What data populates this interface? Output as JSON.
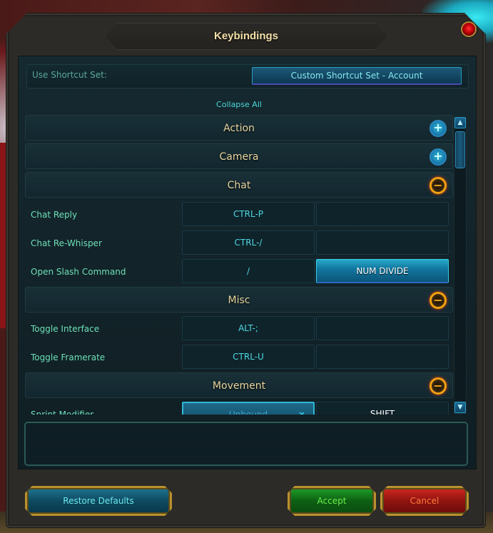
{
  "window": {
    "title": "Keybindings",
    "close_icon": "close-red-orb-icon"
  },
  "shortcut_set": {
    "label": "Use Shortcut Set:",
    "selected": "Custom Shortcut Set - Account"
  },
  "collapse_all_label": "Collapse All",
  "categories": [
    {
      "name": "Action",
      "state": "collapsed",
      "toggle_icon": "plus-icon",
      "toggle_glyph": "+"
    },
    {
      "name": "Camera",
      "state": "collapsed",
      "toggle_icon": "plus-icon",
      "toggle_glyph": "+"
    },
    {
      "name": "Chat",
      "state": "expanded",
      "toggle_icon": "minus-icon",
      "toggle_glyph": "−",
      "bindings": [
        {
          "action": "Chat Reply",
          "primary": "CTRL-P",
          "secondary": ""
        },
        {
          "action": "Chat Re-Whisper",
          "primary": "CTRL-/",
          "secondary": ""
        },
        {
          "action": "Open Slash Command",
          "primary": "/",
          "secondary": "NUM DIVIDE"
        }
      ]
    },
    {
      "name": "Misc",
      "state": "expanded",
      "toggle_icon": "minus-icon",
      "toggle_glyph": "−",
      "bindings": [
        {
          "action": "Toggle Interface",
          "primary": "ALT-;",
          "secondary": ""
        },
        {
          "action": "Toggle Framerate",
          "primary": "CTRL-U",
          "secondary": ""
        }
      ]
    },
    {
      "name": "Movement",
      "state": "expanded",
      "toggle_icon": "minus-icon",
      "toggle_glyph": "−",
      "bindings": [
        {
          "action": "Sprint Modifier",
          "primary": "Unbound",
          "primary_clear": "x",
          "secondary": "SHIFT"
        }
      ]
    }
  ],
  "scrollbar": {
    "up_glyph": "▲",
    "down_glyph": "▼"
  },
  "buttons": {
    "restore_defaults": "Restore Defaults",
    "accept": "Accept",
    "cancel": "Cancel"
  },
  "colors": {
    "title": "#f2dfa6",
    "category": "#e8d6a0",
    "action_label": "#6ee0b8",
    "binding_text": "#4ed8e0",
    "accept": "#6af04a",
    "cancel": "#ff7a3a"
  }
}
